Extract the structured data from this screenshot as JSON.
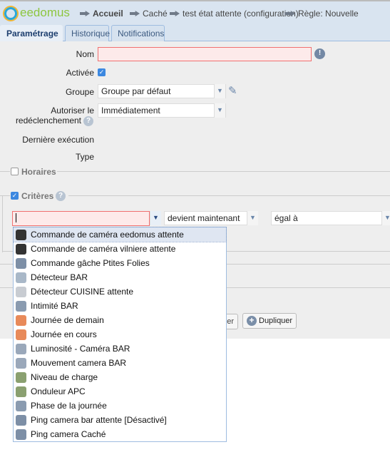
{
  "header": {
    "logo": "eedomus",
    "breadcrumb": [
      "Accueil",
      "Caché",
      "test état attente (configuration)",
      "Règle: Nouvelle"
    ]
  },
  "tabs": [
    "Paramétrage",
    "Historique",
    "Notifications"
  ],
  "form": {
    "nom_label": "Nom",
    "nom_value": "",
    "activee_label": "Activée",
    "activee_checked": true,
    "groupe_label": "Groupe",
    "groupe_value": "Groupe par défaut",
    "autoriser_label_1": "Autoriser le",
    "autoriser_label_2": "redéclenchement",
    "autoriser_value": "Immédiatement",
    "derniere_label": "Dernière exécution",
    "type_label": "Type"
  },
  "sections": {
    "horaires": "Horaires",
    "horaires_checked": false,
    "criteres": "Critères",
    "criteres_checked": true
  },
  "criteria": {
    "device_value": "",
    "condition_value": "devient maintenant",
    "comparator_value": "égal à"
  },
  "buttons": {
    "hidden_partial": "er",
    "dupliquer": "Dupliquer"
  },
  "dropdown": {
    "items": [
      {
        "label": "Commande de caméra eedomus attente",
        "icon": "camera-icon",
        "highlighted": true
      },
      {
        "label": "Commande de caméra vilniere attente",
        "icon": "camera-icon"
      },
      {
        "label": "Commande gâche Ptites Folies",
        "icon": "lock-strike-icon"
      },
      {
        "label": "Détecteur BAR",
        "icon": "detector-icon"
      },
      {
        "label": "Détecteur CUISINE attente",
        "icon": "motion-sensor-icon"
      },
      {
        "label": "Intimité BAR",
        "icon": "privacy-camera-icon"
      },
      {
        "label": "Journée de demain",
        "icon": "calendar-day-icon"
      },
      {
        "label": "Journée en cours",
        "icon": "calendar-day-icon"
      },
      {
        "label": "Luminosité - Caméra BAR",
        "icon": "light-sensor-icon"
      },
      {
        "label": "Mouvement camera BAR",
        "icon": "motion-icon"
      },
      {
        "label": "Niveau de charge",
        "icon": "battery-icon"
      },
      {
        "label": "Onduleur APC",
        "icon": "ups-icon"
      },
      {
        "label": "Phase de la journée",
        "icon": "day-phase-icon"
      },
      {
        "label": "Ping camera bar attente [Désactivé]",
        "icon": "ping-icon"
      },
      {
        "label": "Ping camera Caché",
        "icon": "ping-icon"
      }
    ]
  }
}
